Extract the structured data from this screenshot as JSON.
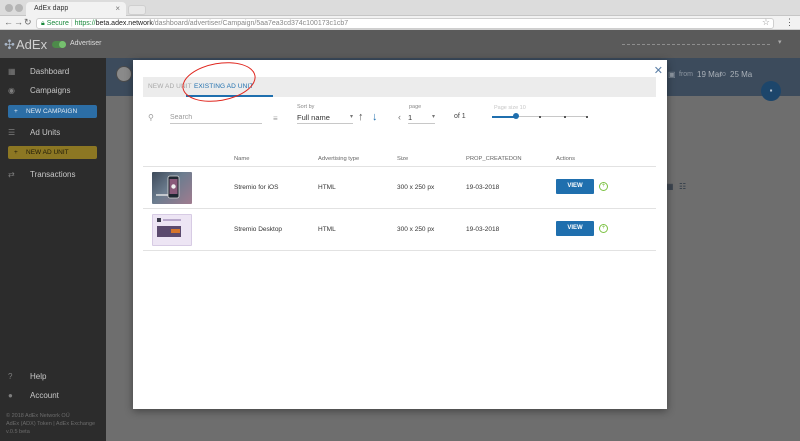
{
  "browser": {
    "tab_title": "AdEx dapp",
    "secure_label": "Secure",
    "url_proto": "https://",
    "url_host": "beta.adex.network",
    "url_path": "/dashboard/advertiser/Campaign/5aa7ea3cd374c100173c1cb7"
  },
  "app": {
    "brand": "AdEx",
    "role": "Advertiser"
  },
  "sidebar": {
    "items": [
      {
        "label": "Dashboard",
        "icon": "dashboard-icon"
      },
      {
        "label": "Campaigns",
        "icon": "campaigns-icon"
      },
      {
        "label": "Ad Units",
        "icon": "list-icon"
      },
      {
        "label": "Transactions",
        "icon": "transactions-icon"
      },
      {
        "label": "Help",
        "icon": "help-icon"
      },
      {
        "label": "Account",
        "icon": "account-icon"
      }
    ],
    "new_campaign": "NEW CAMPAIGN",
    "new_ad_unit": "NEW AD UNIT",
    "footer": [
      "© 2018 AdEx Network OÜ",
      "AdEx (ADX) Token | AdEx Exchange",
      "v.0.5 beta"
    ]
  },
  "campaign_header": {
    "from_label": "from",
    "from_value": "19 Mar",
    "to_label": "to",
    "to_value": "25 Ma"
  },
  "modal": {
    "tabs": {
      "new": "NEW AD UNIT",
      "existing": "EXISTING AD UNIT"
    },
    "search": {
      "placeholder": "Search"
    },
    "sort": {
      "label": "Sort by",
      "value": "Full name"
    },
    "pager": {
      "label": "page",
      "value": "1",
      "of": "of 1"
    },
    "per_page": {
      "label": "Page size 10"
    },
    "table": {
      "headers": [
        "Name",
        "Advertising type",
        "Size",
        "PROP_CREATEDON",
        "Actions"
      ],
      "rows": [
        {
          "name": "Stremio for iOS",
          "type": "HTML",
          "size": "300 x 250 px",
          "created": "19-03-2018",
          "action": "VIEW"
        },
        {
          "name": "Stremio Desktop",
          "type": "HTML",
          "size": "300 x 250 px",
          "created": "19-03-2018",
          "action": "VIEW"
        }
      ]
    }
  },
  "colors": {
    "accent": "#1f6fae",
    "annotation": "#e0261e",
    "add": "#7cc243"
  }
}
